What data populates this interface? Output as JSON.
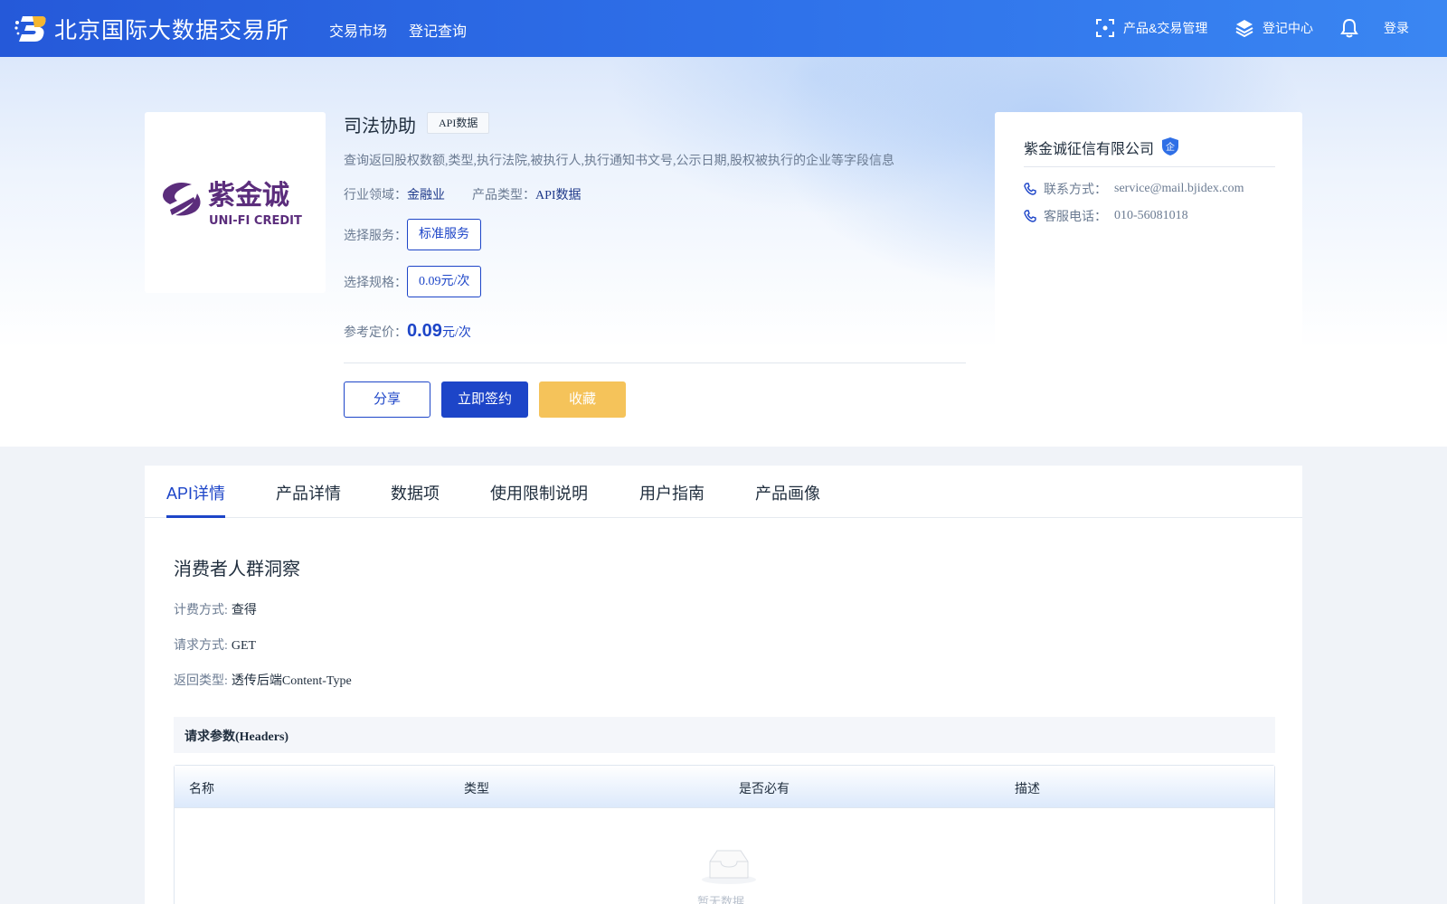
{
  "header": {
    "brand": "北京国际大数据交易所",
    "nav": [
      {
        "label": "交易市场"
      },
      {
        "label": "登记查询"
      }
    ],
    "right": {
      "product_mgmt": "产品&交易管理",
      "register_center": "登记中心",
      "login": "登录"
    }
  },
  "product": {
    "title": "司法协助",
    "tag": "API数据",
    "description": "查询返回股权数额,类型,执行法院,被执行人,执行通知书文号,公示日期,股权被执行的企业等字段信息",
    "industry_label": "行业领域：",
    "industry_value": "金融业",
    "type_label": "产品类型：",
    "type_value": "API数据",
    "service_label": "选择服务：",
    "service_value": "标准服务",
    "spec_label": "选择规格：",
    "spec_value": "0.09元/次",
    "price_label": "参考定价：",
    "price_value": "0.09",
    "price_unit": "元/次",
    "buttons": {
      "share": "分享",
      "sign": "立即签约",
      "favorite": "收藏"
    }
  },
  "vendor": {
    "name": "紫金诚征信有限公司",
    "badge": "企",
    "logo_text": "紫金诚",
    "logo_subtext": "UNI-FI CREDIT",
    "contact_label": "联系方式：",
    "contact_value": "service@mail.bjidex.com",
    "phone_label": "客服电话：",
    "phone_value": "010-56081018"
  },
  "tabs": [
    {
      "label": "API详情",
      "active": true
    },
    {
      "label": "产品详情"
    },
    {
      "label": "数据项"
    },
    {
      "label": "使用限制说明"
    },
    {
      "label": "用户指南"
    },
    {
      "label": "产品画像"
    }
  ],
  "api": {
    "section_title": "消费者人群洞察",
    "billing_label": "计费方式:",
    "billing_value": "查得",
    "method_label": "请求方式:",
    "method_value": "GET",
    "return_label": "返回类型:",
    "return_value": "透传后端Content-Type",
    "headers_title": "请求参数(Headers)",
    "columns": [
      "名称",
      "类型",
      "是否必有",
      "描述"
    ],
    "empty_text": "暂无数据"
  },
  "colors": {
    "primary": "#1d45c8",
    "header_gradient_start": "#2559d9",
    "header_gradient_end": "#3a86f2",
    "favorite": "#f5c35a"
  }
}
